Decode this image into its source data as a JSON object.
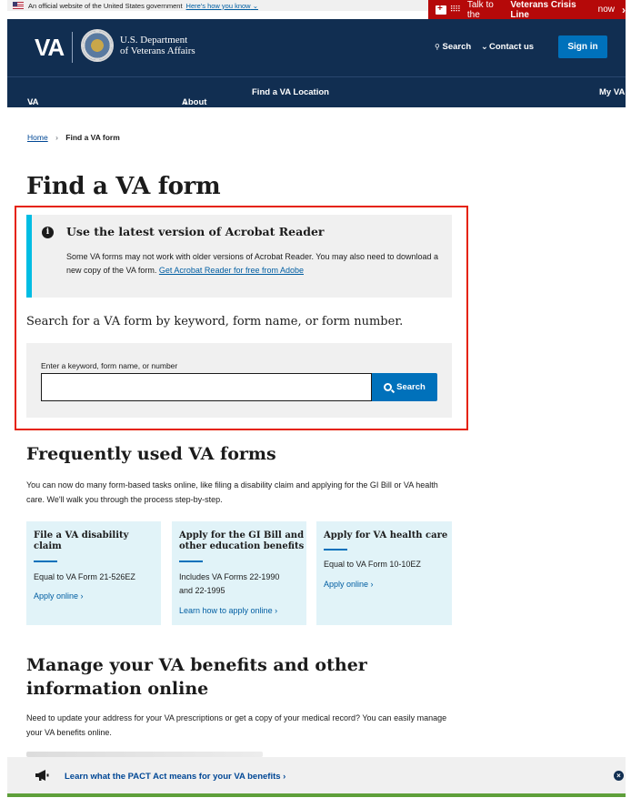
{
  "gov_banner": {
    "text": "An official website of the United States government",
    "link": "Here's how you know"
  },
  "crisis": {
    "prefix": "Talk to the",
    "emphasis": "Veterans Crisis Line",
    "suffix": "now"
  },
  "header": {
    "logo": "VA",
    "dept_line1": "U.S. Department",
    "dept_line2": "of Veterans Affairs",
    "search": "Search",
    "contact": "Contact us",
    "signin": "Sign in"
  },
  "nav": {
    "items": [
      "VA Benefits and Health Care",
      "About VA",
      "Find a VA Location",
      "My VA"
    ]
  },
  "breadcrumb": {
    "home": "Home",
    "current": "Find a VA form"
  },
  "page_title": "Find a VA form",
  "alert": {
    "title": "Use the latest version of Acrobat Reader",
    "body": "Some VA forms may not work with older versions of Acrobat Reader. You may also need to download a new copy of the VA form.",
    "link": "Get Acrobat Reader for free from Adobe"
  },
  "search": {
    "prompt": "Search for a VA form by keyword, form name, or form number.",
    "label": "Enter a keyword, form name, or number",
    "value": "",
    "button": "Search"
  },
  "frequent": {
    "heading": "Frequently used VA forms",
    "description": "You can now do many form-based tasks online, like filing a disability claim and applying for the GI Bill or VA health care. We'll walk you through the process step-by-step.",
    "cards": [
      {
        "title": "File a VA disability claim",
        "text": "Equal to VA Form 21-526EZ",
        "link": "Apply online"
      },
      {
        "title": "Apply for the GI Bill and other education benefits",
        "text": "Includes VA Forms 22-1990 and 22-1995",
        "link": "Learn how to apply online"
      },
      {
        "title": "Apply for VA health care",
        "text": "Equal to VA Form 10-10EZ",
        "link": "Apply online"
      }
    ]
  },
  "manage": {
    "heading": "Manage your VA benefits and other information online",
    "description": "Need to update your address for your VA prescriptions or get a copy of your medical record? You can easily manage your VA benefits online."
  },
  "pact": {
    "text": "Learn what the PACT Act means for your VA benefits"
  },
  "colors": {
    "header_bg": "#112e51",
    "crisis_bg": "#b50909",
    "primary_button": "#0071bb",
    "card_bg": "#e1f3f8",
    "highlight_border": "#e52207",
    "alert_accent": "#00bde3"
  }
}
